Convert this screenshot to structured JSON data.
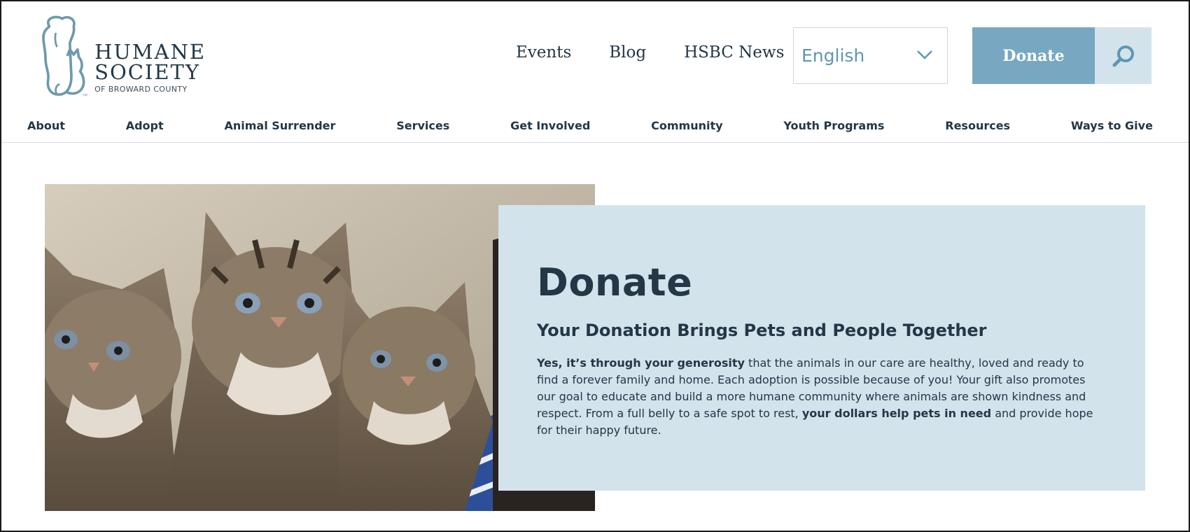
{
  "brand": {
    "logo_line1": "HUMANE",
    "logo_line2": "SOCIETY",
    "logo_line3": "OF BROWARD COUNTY",
    "logo_tm": "TM",
    "color_primary": "#78a8c1",
    "color_light": "#d3e3ec",
    "color_text": "#233746"
  },
  "header": {
    "links": [
      "Events",
      "Blog",
      "HSBC News"
    ],
    "language": {
      "selected": "English",
      "icon": "chevron-down-icon"
    },
    "donate_label": "Donate",
    "search_icon": "search-icon"
  },
  "nav": {
    "items": [
      "About",
      "Adopt",
      "Animal Surrender",
      "Services",
      "Get Involved",
      "Community",
      "Youth Programs",
      "Resources",
      "Ways to Give"
    ]
  },
  "hero": {
    "image_subject": "tabby kittens",
    "title": "Donate",
    "subtitle": "Your Donation Brings Pets and People Together",
    "body_strong_1": "Yes, it’s through your generosity",
    "body_text_1": " that the animals in our care are healthy, loved and ready to find a forever family and home. Each adoption is possible because of you! Your gift also promotes our goal to educate and build a more humane community where animals are shown kindness and respect. From a full belly to a safe spot to rest, ",
    "body_strong_2": "your dollars help pets in need",
    "body_text_2": " and provide hope for their happy future."
  }
}
